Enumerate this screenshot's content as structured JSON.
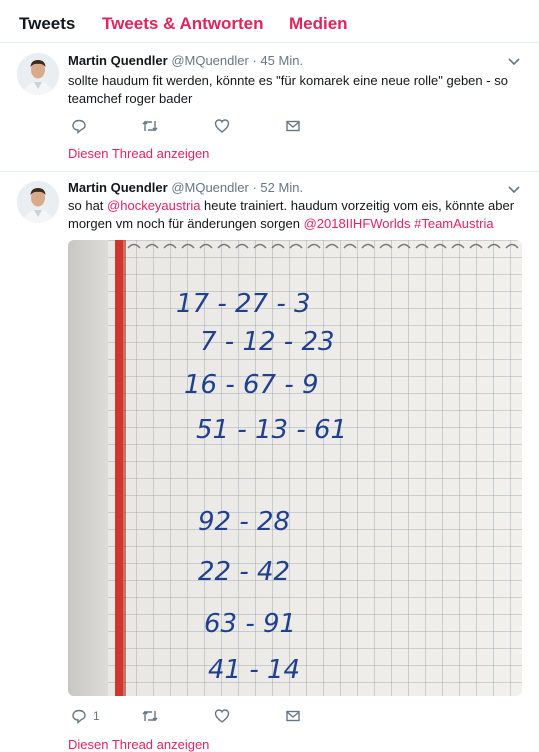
{
  "tabs": [
    {
      "label": "Tweets"
    },
    {
      "label": "Tweets & Antworten"
    },
    {
      "label": "Medien"
    }
  ],
  "tweets": [
    {
      "name": "Martin Quendler",
      "handle": "@MQuendler",
      "separator": "·",
      "time": "45 Min.",
      "text": "sollte haudum fit werden, könnte es \"für komarek eine neue rolle\" geben - so teamchef roger bader",
      "reply_count": "",
      "thread_link": "Diesen Thread anzeigen"
    },
    {
      "name": "Martin Quendler",
      "handle": "@MQuendler",
      "separator": "·",
      "time": "52 Min.",
      "text_parts": {
        "a": "so hat ",
        "b": "@hockeyaustria",
        "c": " heute trainiert. haudum vorzeitig vom eis, könnte aber morgen vm noch für änderungen sorgen ",
        "d": "@2018IIHFWorlds",
        "e": " ",
        "f": "#TeamAustria"
      },
      "reply_count": "1",
      "thread_link": "Diesen Thread anzeigen"
    }
  ],
  "photo_lines": [
    "17 - 27 - 3",
    "7 - 12 - 23",
    "16 - 67 - 9",
    "51 - 13 - 61",
    "92 - 28",
    "22 - 42",
    "63 - 91",
    "41 - 14"
  ],
  "icons": {
    "reply": "reply-icon",
    "retweet": "retweet-icon",
    "like": "heart-icon",
    "dm": "envelope-icon",
    "caret": "chevron-down-icon"
  },
  "colors": {
    "accent": "#e0245e",
    "muted": "#657786",
    "divider": "#e6ecf0"
  }
}
